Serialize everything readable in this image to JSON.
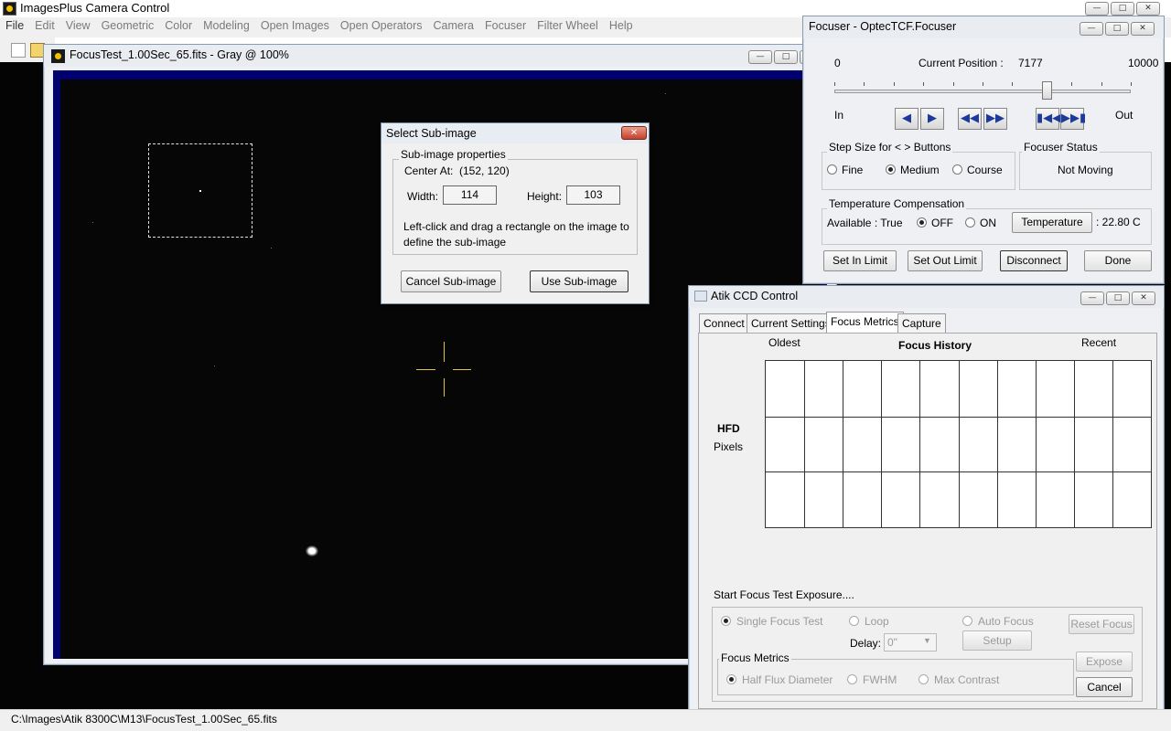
{
  "app": {
    "title": "ImagesPlus Camera Control",
    "menu": [
      "File",
      "Edit",
      "View",
      "Geometric",
      "Color",
      "Modeling",
      "Open Images",
      "Open Operators",
      "Camera",
      "Focuser",
      "Filter Wheel",
      "Help"
    ]
  },
  "status_bar": {
    "path": "C:\\Images\\Atik 8300C\\M13\\FocusTest_1.00Sec_65.fits"
  },
  "image_window": {
    "title": "FocusTest_1.00Sec_65.fits - Gray @ 100%"
  },
  "dialog": {
    "title": "Select Sub-image",
    "group_label": "Sub-image properties",
    "center_label": "Center At:",
    "center_value": "(152, 120)",
    "width_label": "Width:",
    "width_value": "114",
    "height_label": "Height:",
    "height_value": "103",
    "instructions_line1": "Left-click and drag a rectangle on the image to",
    "instructions_line2": "define the sub-image",
    "cancel_label": "Cancel Sub-image",
    "use_label": "Use Sub-image"
  },
  "focuser": {
    "title": "Focuser - OptecTCF.Focuser",
    "min_value": "0",
    "current_position_label": "Current Position :",
    "current_position": "7177",
    "max_value": "10000",
    "in_label": "In",
    "out_label": "Out",
    "slider_position_fraction": 0.7177,
    "step_size_label": "Step Size for < > Buttons",
    "step_fine": "Fine",
    "step_medium": "Medium",
    "step_course": "Course",
    "status_group_label": "Focuser Status",
    "status_value": "Not Moving",
    "temp_comp_label": "Temperature Compensation",
    "available_label": "Available : True",
    "off_label": "OFF",
    "on_label": "ON",
    "temperature_button": "Temperature",
    "temperature_value": ": 22.80 C",
    "set_in_limit": "Set In Limit",
    "set_out_limit": "Set Out Limit",
    "disconnect": "Disconnect",
    "done": "Done"
  },
  "atik": {
    "title": "Atik CCD Control",
    "tabs": [
      "Connect",
      "Current Settings",
      "Focus Metrics",
      "Capture"
    ],
    "oldest_label": "Oldest",
    "history_label": "Focus History",
    "recent_label": "Recent",
    "hfd_label": "HFD",
    "pixels_label": "Pixels",
    "start_label": "Start Focus Test Exposure....",
    "single_focus_test": "Single Focus Test",
    "loop": "Loop",
    "auto_focus": "Auto Focus",
    "delay_label": "Delay:",
    "delay_value": "0\"",
    "setup": "Setup",
    "reset_focus": "Reset Focus",
    "focus_metrics_label": "Focus Metrics",
    "half_flux": "Half Flux Diameter",
    "fwhm": "FWHM",
    "max_contrast": "Max Contrast",
    "expose": "Expose",
    "cancel": "Cancel"
  }
}
